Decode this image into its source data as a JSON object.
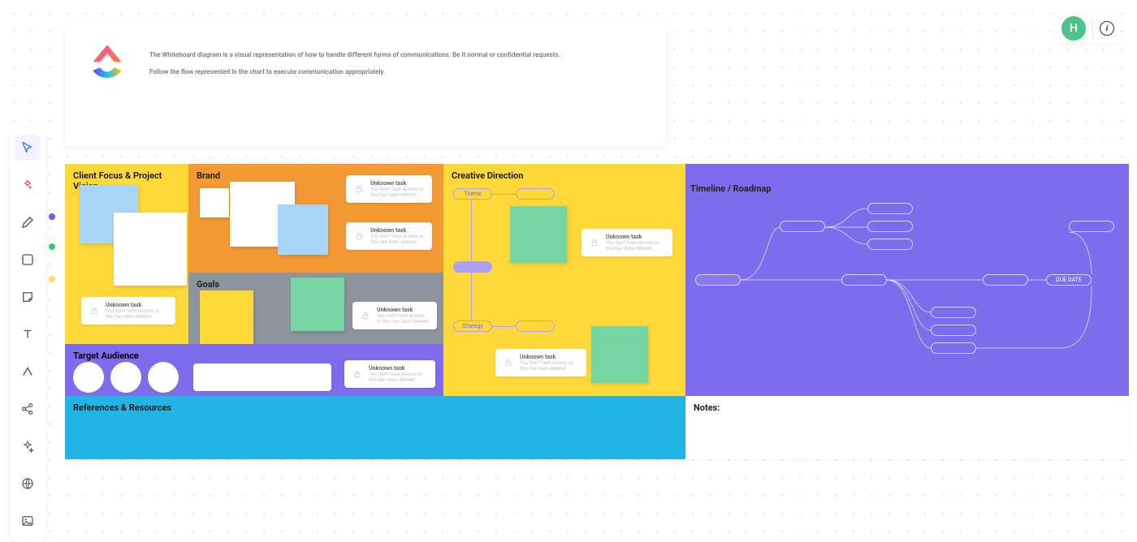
{
  "user": {
    "initial": "H"
  },
  "info_card": {
    "line1": "The Whiteboard diagram is a visual representation of how to handle different forms of communications. Be it normal or confidential requests.",
    "line2": "Follow the flow represented in the chart to execute communication appropriately."
  },
  "toolbar": {
    "tool_cursor": "cursor",
    "tool_templates": "templates",
    "tool_pen": "pen",
    "tool_shape": "shape",
    "tool_sticky": "sticky",
    "tool_text": "text",
    "tool_connector": "connector",
    "tool_mindmap": "mindmap",
    "tool_ai": "ai",
    "tool_web": "web",
    "tool_image": "image"
  },
  "colors": {
    "yellow": "#fed939",
    "orange": "#f39a34",
    "gray": "#8e949c",
    "purple": "#7e6cec",
    "cyan": "#23b4e6",
    "lightblue": "#a8d6f8",
    "white": "#ffffff",
    "green": "#75d6a1",
    "lightpurple": "#b9abf3"
  },
  "sections": {
    "client_focus": {
      "label": "Client Focus & Project Vision"
    },
    "brand": {
      "label": "Brand"
    },
    "goals": {
      "label": "Goals"
    },
    "target_audience": {
      "label": "Target Audience"
    },
    "creative_direction": {
      "label": "Creative Direction",
      "chip_theme": "Theme",
      "chip_strategy": "Strategy"
    },
    "timeline": {
      "label": "Timeline / Roadmap",
      "due_date": "DUE DATE"
    },
    "references": {
      "label": "References & Resources"
    },
    "notes": {
      "label": "Notes:"
    }
  },
  "task_card": {
    "title": "Unknown task",
    "subtitle": "You don't have access or this has been deleted"
  }
}
